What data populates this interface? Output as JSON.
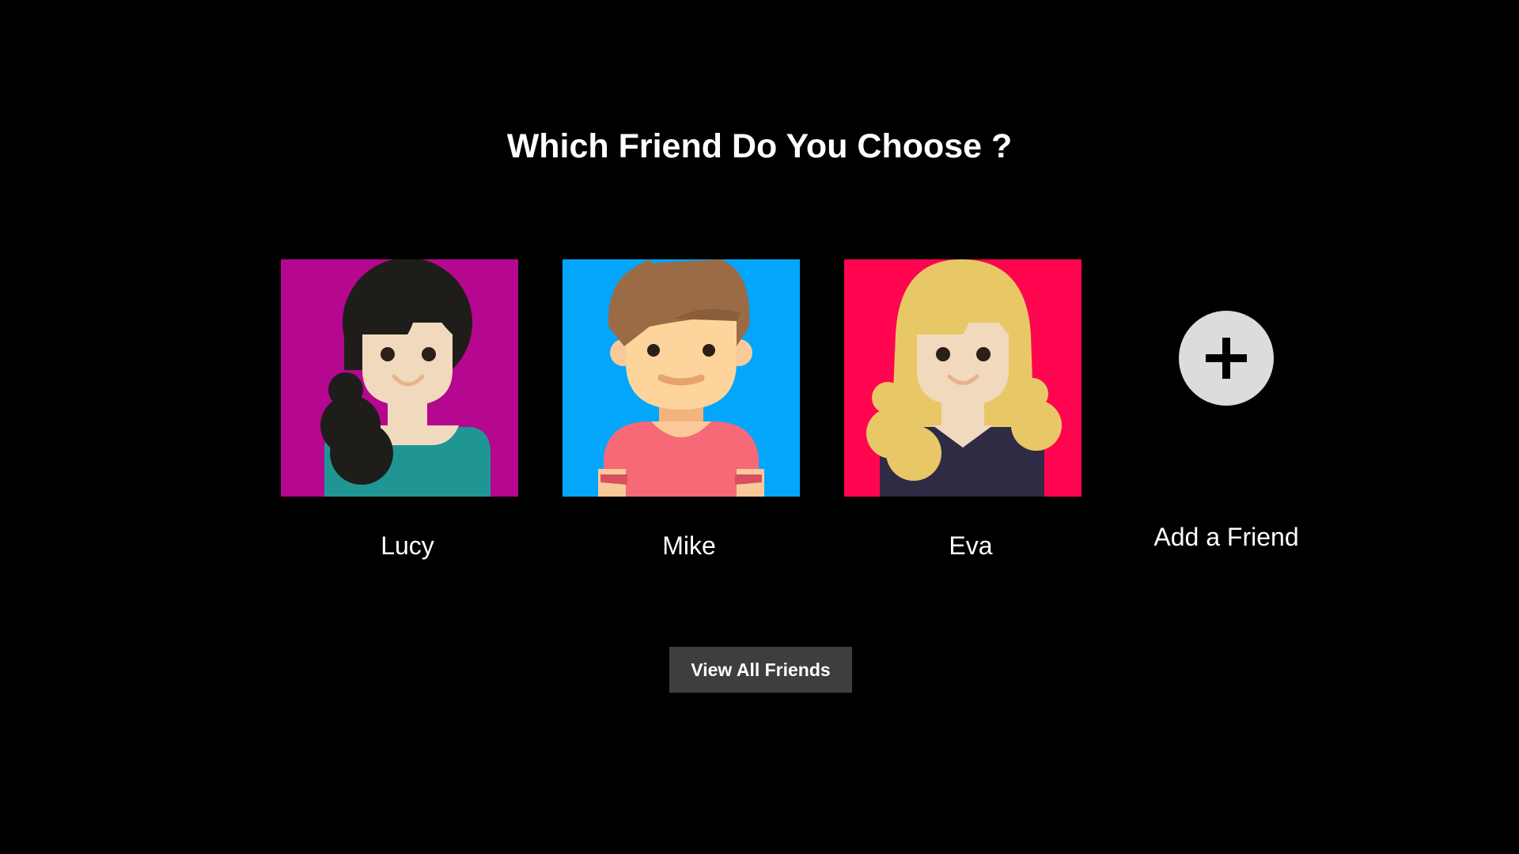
{
  "title": "Which Friend Do You Choose ?",
  "friends": [
    {
      "name": "Lucy",
      "bg_color": "#b5078f",
      "hair_color": "#1f1d1a",
      "shirt_color": "#1f9694"
    },
    {
      "name": "Mike",
      "bg_color": "#03a6fb",
      "hair_color": "#9b6b45",
      "shirt_color": "#f66977"
    },
    {
      "name": "Eva",
      "bg_color": "#ff0550",
      "hair_color": "#e8c866",
      "shirt_color": "#2f2b45"
    }
  ],
  "add_friend": {
    "label": "Add a Friend",
    "icon": "plus-icon"
  },
  "view_all_label": "View All Friends",
  "colors": {
    "background": "#000000",
    "skin": "#f0d9bd",
    "button_bg": "#3e3e3e",
    "add_circle": "#dcdcdc"
  }
}
